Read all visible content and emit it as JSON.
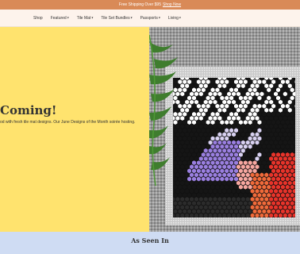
{
  "promo": {
    "text": "Free Shipping Over $95",
    "link": "Shop Now"
  },
  "nav": {
    "items": [
      {
        "label": "Shop",
        "has_menu": false
      },
      {
        "label": "Featured",
        "has_menu": true
      },
      {
        "label": "Tile Mat",
        "has_menu": true
      },
      {
        "label": "Tile Set Bundles",
        "has_menu": true
      },
      {
        "label": "Passports",
        "has_menu": true
      },
      {
        "label": "Living",
        "has_menu": true
      }
    ]
  },
  "hero": {
    "title": "Coming!",
    "description": "od with fresh tile mat designs. Our June Designs of the Month soirée hosting.",
    "image_icon": "hex-tile-mat-photo"
  },
  "press": {
    "title": "As Seen In"
  },
  "colors": {
    "promo_bg": "#d98a57",
    "nav_bg": "#fdf3ec",
    "hero_bg": "#ffe36e",
    "press_bg": "#cfdcf3"
  }
}
